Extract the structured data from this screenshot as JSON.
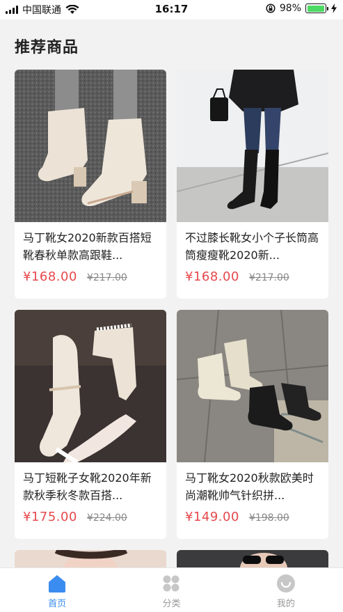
{
  "status_bar": {
    "carrier": "中国联通",
    "time": "16:17",
    "battery": "98%",
    "battery_level": 0.98
  },
  "page": {
    "title": "推荐商品"
  },
  "products": [
    {
      "name": "马丁靴女2020新款百搭短靴春秋单款高跟鞋...",
      "price": "¥168.00",
      "old_price": "¥217.00"
    },
    {
      "name": "不过膝长靴女小个子长筒高筒瘦瘦靴2020新...",
      "price": "¥168.00",
      "old_price": "¥217.00"
    },
    {
      "name": "马丁短靴子女靴2020年新款秋季秋冬款百搭...",
      "price": "¥175.00",
      "old_price": "¥224.00"
    },
    {
      "name": "马丁靴女2020秋款欧美时尚潮靴帅气针织拼...",
      "price": "¥149.00",
      "old_price": "¥198.00"
    }
  ],
  "tabbar": {
    "items": [
      {
        "label": "首页",
        "icon": "home-icon",
        "active": true
      },
      {
        "label": "分类",
        "icon": "category-icon",
        "active": false
      },
      {
        "label": "我的",
        "icon": "profile-icon",
        "active": false
      }
    ]
  },
  "colors": {
    "accent": "#3b8cf0",
    "price": "#e5484d",
    "battery": "#4cd964"
  }
}
